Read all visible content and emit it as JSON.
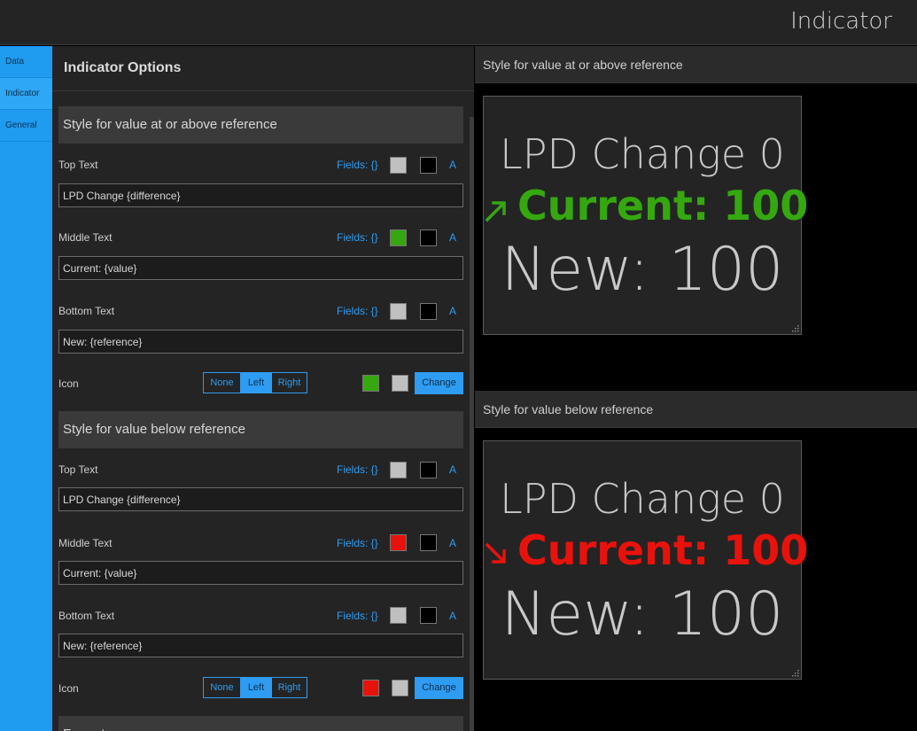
{
  "header": {
    "title": "Indicator"
  },
  "sidebar": {
    "items": [
      {
        "label": "Data"
      },
      {
        "label": "Indicator"
      },
      {
        "label": "General"
      }
    ]
  },
  "options": {
    "title": "Indicator Options",
    "sections": [
      {
        "title": "Style for value at or above reference",
        "rows": [
          {
            "label": "Top Text",
            "fields": "Fields: {}",
            "a": "A",
            "color": "#c0c0c0",
            "bg": "#000000",
            "value": "LPD Change {difference}"
          },
          {
            "label": "Middle Text",
            "fields": "Fields: {}",
            "a": "A",
            "color": "#35a80f",
            "bg": "#000000",
            "value": "Current: {value}"
          },
          {
            "label": "Bottom Text",
            "fields": "Fields: {}",
            "a": "A",
            "color": "#c0c0c0",
            "bg": "#000000",
            "value": "New: {reference}"
          }
        ],
        "icon": {
          "label": "Icon",
          "options": [
            "None",
            "Left",
            "Right"
          ],
          "selected": "Left",
          "color": "#35a80f",
          "bg": "#c0c0c0",
          "change_label": "Change"
        }
      },
      {
        "title": "Style for value below reference",
        "rows": [
          {
            "label": "Top Text",
            "fields": "Fields: {}",
            "a": "A",
            "color": "#c0c0c0",
            "bg": "#000000",
            "value": "LPD Change {difference}"
          },
          {
            "label": "Middle Text",
            "fields": "Fields: {}",
            "a": "A",
            "color": "#e8120c",
            "bg": "#000000",
            "value": "Current: {value}"
          },
          {
            "label": "Bottom Text",
            "fields": "Fields: {}",
            "a": "A",
            "color": "#c0c0c0",
            "bg": "#000000",
            "value": "New: {reference}"
          }
        ],
        "icon": {
          "label": "Icon",
          "options": [
            "None",
            "Left",
            "Right"
          ],
          "selected": "Left",
          "color": "#e8120c",
          "bg": "#c0c0c0",
          "change_label": "Change"
        }
      }
    ],
    "next_section_partial": "Format"
  },
  "previews": [
    {
      "title": "Style for value at or above reference",
      "top": "LPD Change 0",
      "middle": "Current: 100",
      "bottom": "New: 100",
      "middle_color": "#35a80f",
      "icon": "arrow-up-right-icon"
    },
    {
      "title": "Style for value below reference",
      "top": "LPD Change 0",
      "middle": "Current: 100",
      "bottom": "New: 100",
      "middle_color": "#e8120c",
      "icon": "arrow-down-right-icon"
    }
  ]
}
